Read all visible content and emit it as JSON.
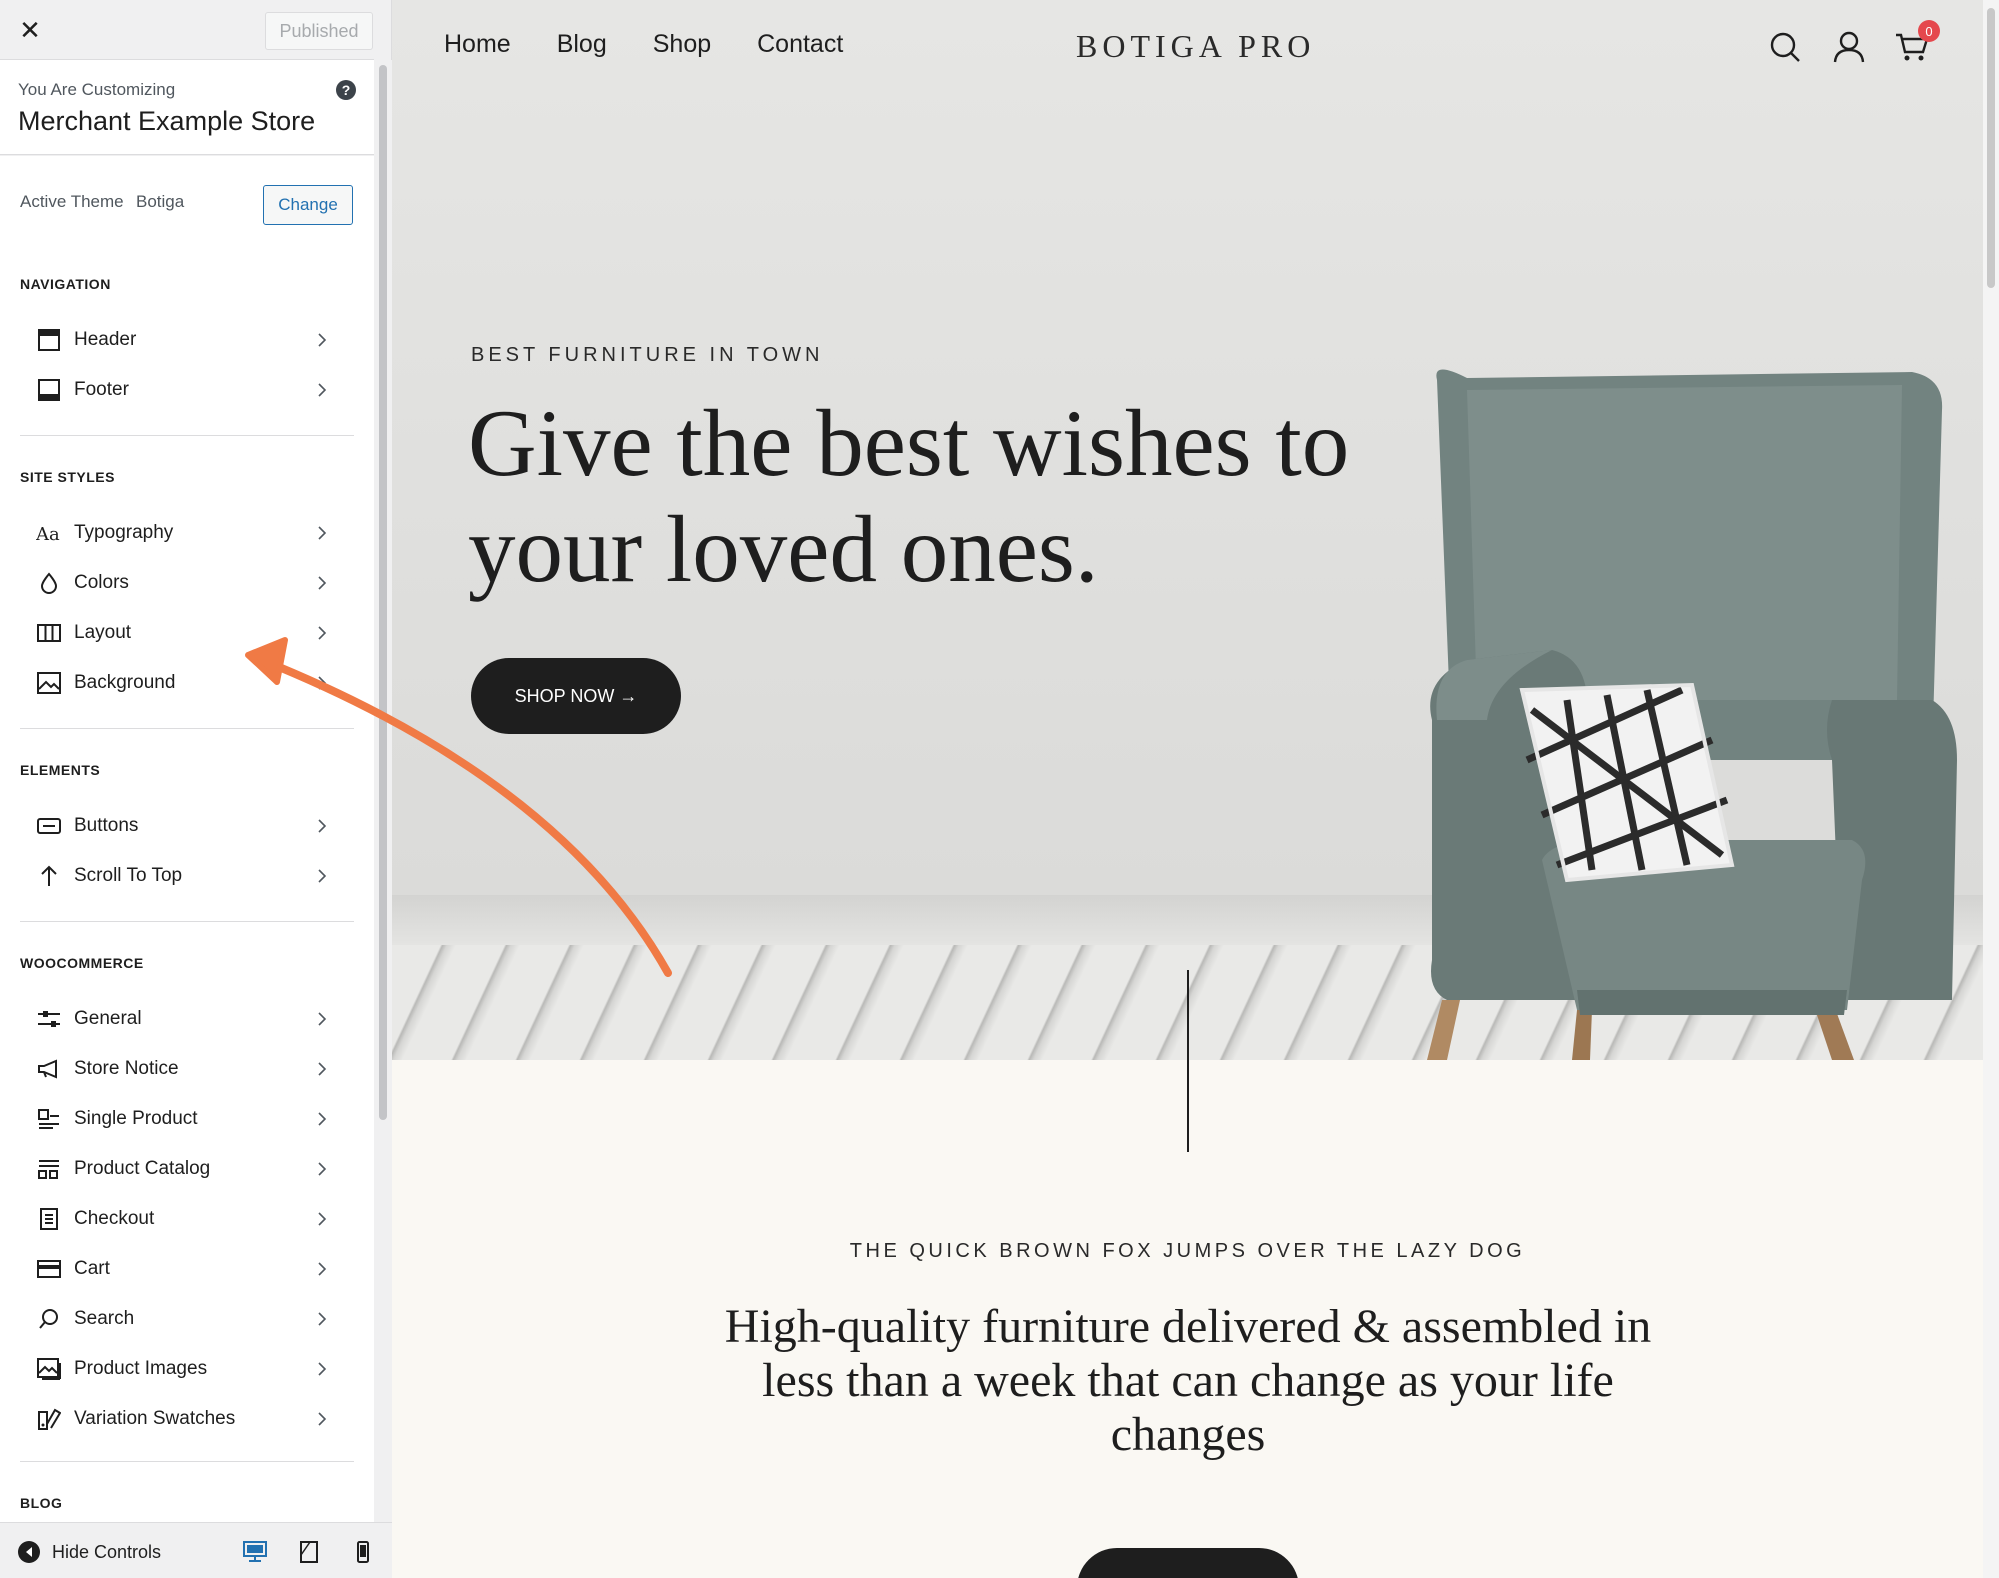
{
  "customizer": {
    "close_label": "✕",
    "published_label": "Published",
    "customizing_label": "You Are Customizing",
    "store_name": "Merchant Example Store",
    "help_label": "?",
    "active_theme_label": "Active Theme",
    "active_theme_name": "Botiga",
    "change_label": "Change",
    "sections": {
      "navigation": {
        "title": "NAVIGATION",
        "items": [
          {
            "label": "Header",
            "icon": "header-layout-icon"
          },
          {
            "label": "Footer",
            "icon": "footer-layout-icon"
          }
        ]
      },
      "site_styles": {
        "title": "SITE STYLES",
        "items": [
          {
            "label": "Typography",
            "icon": "typography-icon"
          },
          {
            "label": "Colors",
            "icon": "droplet-icon"
          },
          {
            "label": "Layout",
            "icon": "columns-icon"
          },
          {
            "label": "Background",
            "icon": "image-icon"
          }
        ]
      },
      "elements": {
        "title": "ELEMENTS",
        "items": [
          {
            "label": "Buttons",
            "icon": "button-icon"
          },
          {
            "label": "Scroll To Top",
            "icon": "arrow-up-icon"
          }
        ]
      },
      "woocommerce": {
        "title": "WOOCOMMERCE",
        "items": [
          {
            "label": "General",
            "icon": "sliders-icon"
          },
          {
            "label": "Store Notice",
            "icon": "megaphone-icon"
          },
          {
            "label": "Single Product",
            "icon": "single-product-icon"
          },
          {
            "label": "Product Catalog",
            "icon": "catalog-icon"
          },
          {
            "label": "Checkout",
            "icon": "checkout-icon"
          },
          {
            "label": "Cart",
            "icon": "card-icon"
          },
          {
            "label": "Search",
            "icon": "search-icon"
          },
          {
            "label": "Product Images",
            "icon": "gallery-icon"
          },
          {
            "label": "Variation Swatches",
            "icon": "swatches-icon"
          }
        ]
      },
      "blog": {
        "title": "BLOG"
      }
    },
    "footer": {
      "hide_controls_label": "Hide Controls",
      "devices": [
        "desktop-icon",
        "tablet-icon",
        "mobile-icon"
      ]
    }
  },
  "preview": {
    "nav": [
      "Home",
      "Blog",
      "Shop",
      "Contact"
    ],
    "logo": "BOTIGA PRO",
    "cart_count": "0",
    "hero": {
      "kicker": "BEST FURNITURE IN TOWN",
      "title": "Give the best wishes to your loved ones.",
      "cta": "SHOP NOW →"
    },
    "section2": {
      "kicker": "THE QUICK BROWN FOX JUMPS OVER THE LAZY DOG",
      "headline": "High-quality furniture delivered & assembled in less than a week that can change as your life changes"
    }
  },
  "colors": {
    "accent": "#2271b1",
    "annotation_arrow": "#f07a45",
    "badge": "#e5484d"
  }
}
